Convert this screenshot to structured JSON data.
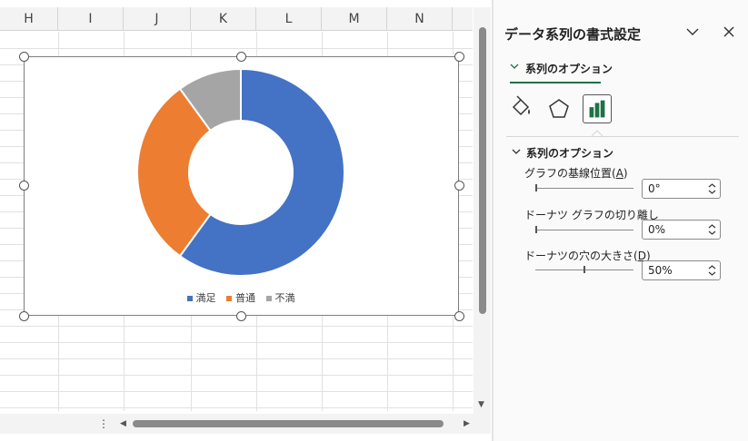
{
  "sheet": {
    "columns": [
      "H",
      "I",
      "J",
      "K",
      "L",
      "M",
      "N"
    ]
  },
  "chart_data": {
    "type": "pie",
    "categories": [
      "満足",
      "普通",
      "不満"
    ],
    "values": [
      60,
      30,
      10
    ],
    "colors": [
      "#4472c4",
      "#ed7d31",
      "#a5a5a5"
    ],
    "hole_percent": 50,
    "title": "",
    "legend_position": "bottom"
  },
  "pane": {
    "title": "データ系列の書式設定",
    "tab_label": "系列のオプション",
    "icons": [
      "fill-bucket-icon",
      "pentagon-effects-icon",
      "bar-chart-series-icon"
    ],
    "section_header": "系列のオプション",
    "options": [
      {
        "label": "グラフの基線位置(",
        "accel": "A",
        "label_end": ")",
        "value": "0°",
        "level": 0
      },
      {
        "label": "ドーナツ グラフの切り離し",
        "accel": "",
        "label_end": "",
        "value": "0%",
        "level": 0
      },
      {
        "label": "ドーナツの穴の大きさ(",
        "accel": "D",
        "label_end": ")",
        "value": "50%",
        "level": 0.5
      }
    ]
  }
}
